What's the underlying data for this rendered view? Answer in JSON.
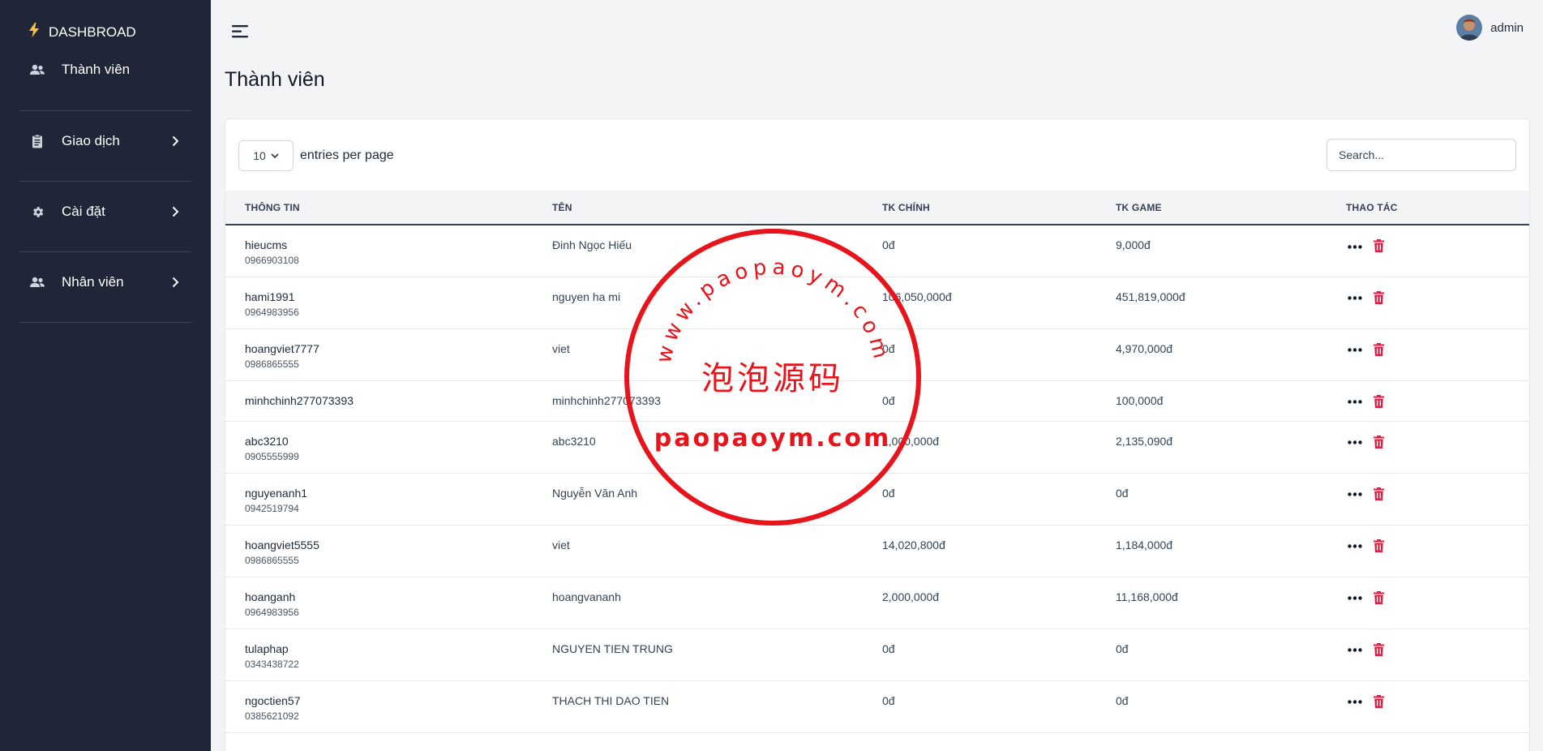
{
  "sidebar": {
    "brand": "DASHBROAD",
    "items": [
      {
        "label": "Thành viên"
      },
      {
        "label": "Giao dịch"
      },
      {
        "label": "Cài đặt"
      },
      {
        "label": "Nhân viên"
      }
    ]
  },
  "header": {
    "user_name": "admin"
  },
  "page": {
    "title": "Thành viên"
  },
  "table_controls": {
    "per_page_value": "10",
    "per_page_label": "entries per page",
    "search_placeholder": "Search..."
  },
  "table": {
    "columns": [
      "THÔNG TIN",
      "TÊN",
      "TK CHÍNH",
      "TK GAME",
      "THAO TÁC"
    ],
    "rows": [
      {
        "username": "hieucms",
        "phone": "0966903108",
        "name": "Đinh Ngọc Hiếu",
        "main": "0đ",
        "game": "9,000đ"
      },
      {
        "username": "hami1991",
        "phone": "0964983956",
        "name": "nguyen ha mi",
        "main": "106,050,000đ",
        "game": "451,819,000đ"
      },
      {
        "username": "hoangviet7777",
        "phone": "0986865555",
        "name": "viet",
        "main": "0đ",
        "game": "4,970,000đ"
      },
      {
        "username": "minhchinh277073393",
        "phone": "",
        "name": "minhchinh277073393",
        "main": "0đ",
        "game": "100,000đ"
      },
      {
        "username": "abc3210",
        "phone": "0905555999",
        "name": "abc3210",
        "main": "1,000,000đ",
        "game": "2,135,090đ"
      },
      {
        "username": "nguyenanh1",
        "phone": "0942519794",
        "name": "Nguyễn Văn Anh",
        "main": "0đ",
        "game": "0đ"
      },
      {
        "username": "hoangviet5555",
        "phone": "0986865555",
        "name": "viet",
        "main": "14,020,800đ",
        "game": "1,184,000đ"
      },
      {
        "username": "hoanganh",
        "phone": "0964983956",
        "name": "hoangvananh",
        "main": "2,000,000đ",
        "game": "11,168,000đ"
      },
      {
        "username": "tulaphap",
        "phone": "0343438722",
        "name": "NGUYEN TIEN TRUNG",
        "main": "0đ",
        "game": "0đ"
      },
      {
        "username": "ngoctien57",
        "phone": "0385621092",
        "name": "THACH THI DAO TIEN",
        "main": "0đ",
        "game": "0đ"
      }
    ]
  },
  "watermark": {
    "top_text": "www.paopaoym.com",
    "middle_text": "泡泡源码",
    "bottom_text": "paopaoym.com",
    "color": "#e8141b"
  },
  "colors": {
    "sidebar_bg": "#1e2637",
    "delete": "#e11d48",
    "bolt": "#f6c344"
  }
}
